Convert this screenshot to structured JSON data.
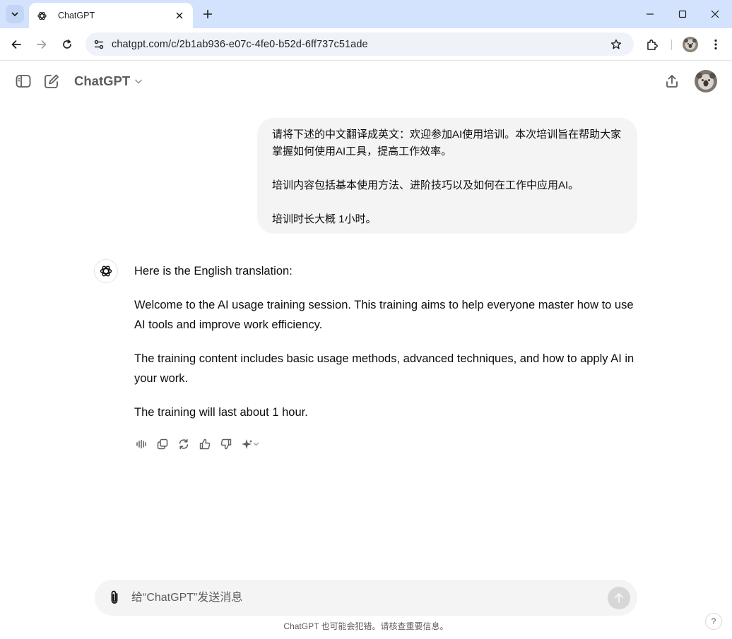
{
  "browser": {
    "tab_title": "ChatGPT",
    "url": "chatgpt.com/c/2b1ab936-e07c-4fe0-b52d-6ff737c51ade",
    "icons": [
      "tab-search-icon",
      "openai-favicon",
      "close-icon",
      "plus-icon",
      "minimize-icon",
      "maximize-icon",
      "close-window-icon",
      "back-arrow-icon",
      "forward-arrow-icon",
      "reload-icon",
      "site-info-icon",
      "star-icon",
      "extensions-icon",
      "profile-avatar",
      "kebab-menu-icon"
    ]
  },
  "header": {
    "model_name": "ChatGPT",
    "icons": [
      "sidebar-toggle-icon",
      "new-chat-icon",
      "chevron-down-icon",
      "share-icon",
      "user-avatar"
    ]
  },
  "conversation": {
    "user_message": {
      "paragraphs": [
        "请将下述的中文翻译成英文：欢迎参加AI使用培训。本次培训旨在帮助大家掌握如何使用AI工具，提高工作效率。",
        "培训内容包括基本使用方法、进阶技巧以及如何在工作中应用AI。",
        "培训时长大概 1小时。"
      ]
    },
    "assistant_message": {
      "paragraphs": [
        "Here is the English translation:",
        "Welcome to the AI usage training session. This training aims to help everyone master how to use AI tools and improve work efficiency.",
        "The training content includes basic usage methods, advanced techniques, and how to apply AI in your work.",
        "The training will last about 1 hour."
      ],
      "action_icons": [
        "read-aloud-icon",
        "copy-icon",
        "regenerate-icon",
        "thumbs-up-icon",
        "thumbs-down-icon",
        "sparkle-model-icon"
      ]
    }
  },
  "composer": {
    "placeholder": "给“ChatGPT”发送消息",
    "disclaimer": "ChatGPT 也可能会犯错。请核查重要信息。",
    "help_label": "?"
  },
  "colors": {
    "tabstrip_bg": "#d3e3fd",
    "omnibox_bg": "#eff3f9",
    "bubble_bg": "#f4f4f4",
    "text": "#0d0d0d",
    "muted": "#5d5d5d"
  }
}
